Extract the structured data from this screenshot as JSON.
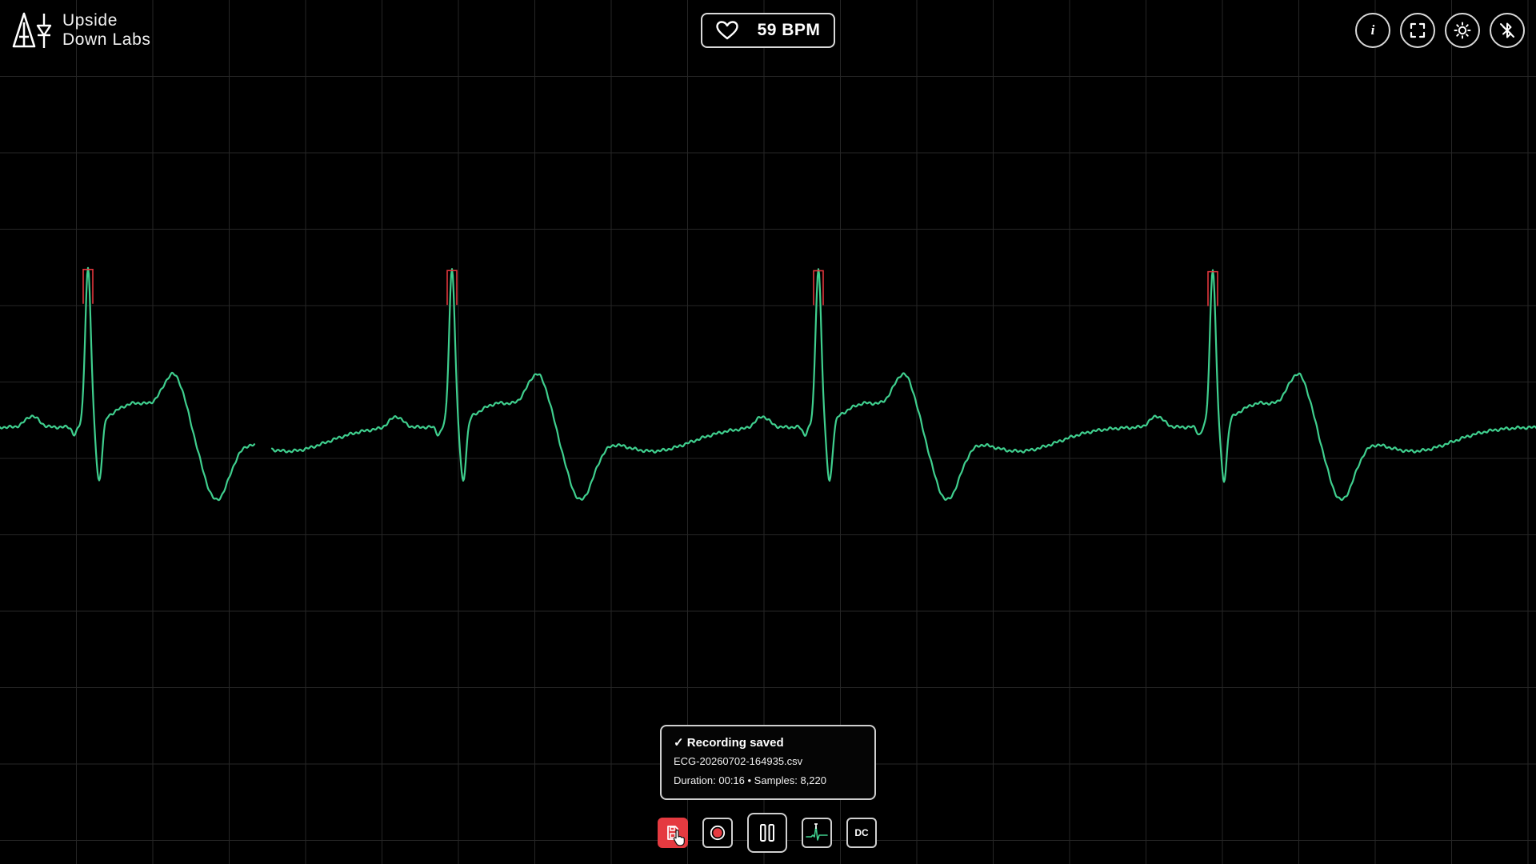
{
  "app": {
    "logo_line1": "Upside",
    "logo_line2": "Down Labs",
    "logo_icon": "upside-down-labs-logo"
  },
  "heart_rate": {
    "icon": "heart-icon",
    "value": 59,
    "unit": "BPM",
    "display": "59 BPM"
  },
  "toolbar_top": [
    {
      "name": "info-button",
      "icon": "info-icon",
      "glyph": "i"
    },
    {
      "name": "fullscreen-button",
      "icon": "fullscreen-icon"
    },
    {
      "name": "theme-button",
      "icon": "sun-icon"
    },
    {
      "name": "bluetooth-button",
      "icon": "bluetooth-off-icon"
    }
  ],
  "notification": {
    "title": "✓ Recording saved",
    "filename": "ECG-20260702-164935.csv",
    "details": "Duration: 00:16  •  Samples: 8,220"
  },
  "controls": [
    {
      "name": "save-recording-button",
      "icon": "save-icon",
      "active": true
    },
    {
      "name": "record-button",
      "icon": "record-icon"
    },
    {
      "name": "pause-button",
      "icon": "pause-icon"
    },
    {
      "name": "peak-detection-button",
      "icon": "ecg-peak-icon"
    },
    {
      "name": "dc-filter-button",
      "label": "DC"
    }
  ],
  "signal": {
    "type": "ECG",
    "r_peaks_marked": 4
  },
  "colors": {
    "background": "#000000",
    "trace": "#3fcf8e",
    "peak_marker": "#e0363c",
    "grid": "#262626",
    "save_button": "#e53a40"
  }
}
